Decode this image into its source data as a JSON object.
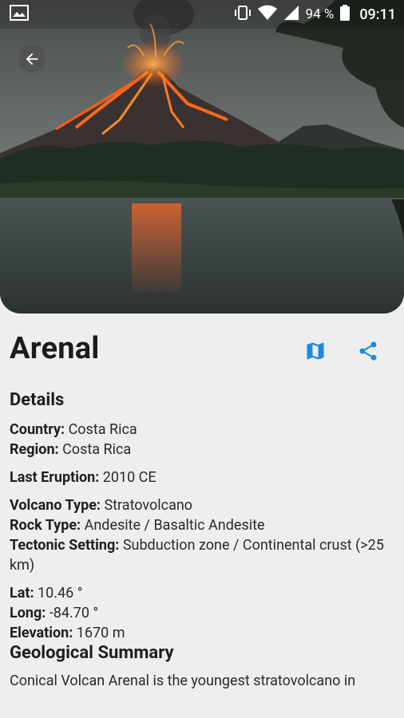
{
  "status_bar": {
    "battery_percent": "94 %",
    "time": "09:11",
    "icons": [
      "gallery-notification-icon",
      "vibrate-icon",
      "wifi-icon",
      "cell-signal-icon",
      "battery-icon"
    ]
  },
  "header": {
    "back_icon": "arrow-back-icon"
  },
  "volcano": {
    "name": "Arenal",
    "map_icon": "map-icon",
    "share_icon": "share-icon"
  },
  "details": {
    "heading": "Details",
    "country_label": "Country:",
    "country_value": "Costa Rica",
    "region_label": "Region:",
    "region_value": "Costa Rica",
    "last_eruption_label": "Last Eruption:",
    "last_eruption_value": "2010 CE",
    "volcano_type_label": "Volcano Type:",
    "volcano_type_value": "Stratovolcano",
    "rock_type_label": "Rock Type:",
    "rock_type_value": "Andesite / Basaltic Andesite",
    "tectonic_label": "Tectonic Setting:",
    "tectonic_value": "Subduction zone / Continental crust (>25 km)",
    "lat_label": "Lat:",
    "lat_value": "10.46 °",
    "long_label": "Long:",
    "long_value": "-84.70 °",
    "elevation_label": "Elevation:",
    "elevation_value": "1670 m"
  },
  "summary": {
    "heading": "Geological Summary",
    "text": "Conical Volcan Arenal is the youngest stratovolcano in"
  },
  "colors": {
    "accent": "#1e88e5",
    "background": "#eeeeee"
  }
}
